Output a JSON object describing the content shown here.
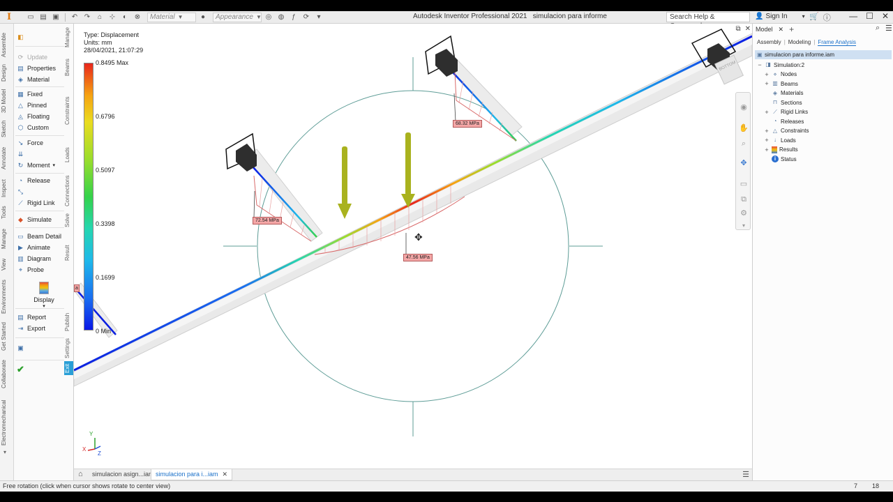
{
  "titlebar": {
    "app_title": "Autodesk Inventor Professional 2021",
    "doc_title": "simulacion para informe",
    "material_combo": "Material",
    "appearance_combo": "Appearance",
    "search_placeholder": "Search Help & Commands...",
    "signin": "Sign In"
  },
  "vtabs": [
    "Assemble",
    "Design",
    "3D Model",
    "Sketch",
    "Annotate",
    "Inspect",
    "Tools",
    "Manage",
    "View",
    "Environments",
    "Get Started",
    "Collaborate",
    "Electromechanical"
  ],
  "panel": {
    "group_labels": [
      "Manage",
      "Beams",
      "Constraints",
      "Loads",
      "Connections",
      "Solve",
      "Result",
      "Display",
      "Publish",
      "Settings",
      "Exit"
    ],
    "items": {
      "update": "Update",
      "properties": "Properties",
      "material": "Material",
      "fixed": "Fixed",
      "pinned": "Pinned",
      "floating": "Floating",
      "custom": "Custom",
      "force": "Force",
      "moment": "Moment",
      "release": "Release",
      "rigid_link": "Rigid Link",
      "simulate": "Simulate",
      "beam_detail": "Beam Detail",
      "animate": "Animate",
      "diagram": "Diagram",
      "probe": "Probe",
      "display": "Display",
      "report": "Report",
      "export": "Export"
    }
  },
  "viewport": {
    "result_type": "Type: Displacement",
    "units": "Units: mm",
    "timestamp": "28/04/2021, 21:07:29",
    "legend": [
      "0.8495 Max",
      "0.6796",
      "0.5097",
      "0.3398",
      "0.1699",
      "0 Min"
    ],
    "stress_tags": {
      "left": "72.54 MPa",
      "top": "68.32 MPa",
      "center": "47.56 MPa",
      "edge": "a"
    },
    "viewcube_label": "BOTTOM",
    "axis": {
      "x": "X",
      "y": "Y",
      "z": "Z"
    }
  },
  "doctabs": [
    {
      "label": "simulacion asign...iam",
      "active": false
    },
    {
      "label": "simulacion para i...iam",
      "active": true
    }
  ],
  "statusbar": {
    "message": "Free rotation (click when cursor shows rotate to center view)",
    "count1": "7",
    "count2": "18"
  },
  "browser": {
    "tab_model": "Model",
    "filters": [
      "Assembly",
      "Modeling",
      "Frame Analysis"
    ],
    "root": "simulacion para informe.iam",
    "tree": [
      {
        "label": "Simulation:2",
        "level": 0,
        "exp": "−"
      },
      {
        "label": "Nodes",
        "level": 1,
        "exp": "+"
      },
      {
        "label": "Beams",
        "level": 1,
        "exp": "+"
      },
      {
        "label": "Materials",
        "level": 1,
        "exp": ""
      },
      {
        "label": "Sections",
        "level": 1,
        "exp": ""
      },
      {
        "label": "Rigid Links",
        "level": 1,
        "exp": "+"
      },
      {
        "label": "Releases",
        "level": 1,
        "exp": ""
      },
      {
        "label": "Constraints",
        "level": 1,
        "exp": "+"
      },
      {
        "label": "Loads",
        "level": 1,
        "exp": "+"
      },
      {
        "label": "Results",
        "level": 1,
        "exp": "+"
      },
      {
        "label": "Status",
        "level": 1,
        "exp": ""
      }
    ]
  },
  "colors": {
    "accent": "#1a70c9",
    "exit_tab": "#2a9fd6",
    "tag_fill": "#f4a7a7",
    "load_arrow": "#a9b21e",
    "check": "#2ca02c"
  }
}
